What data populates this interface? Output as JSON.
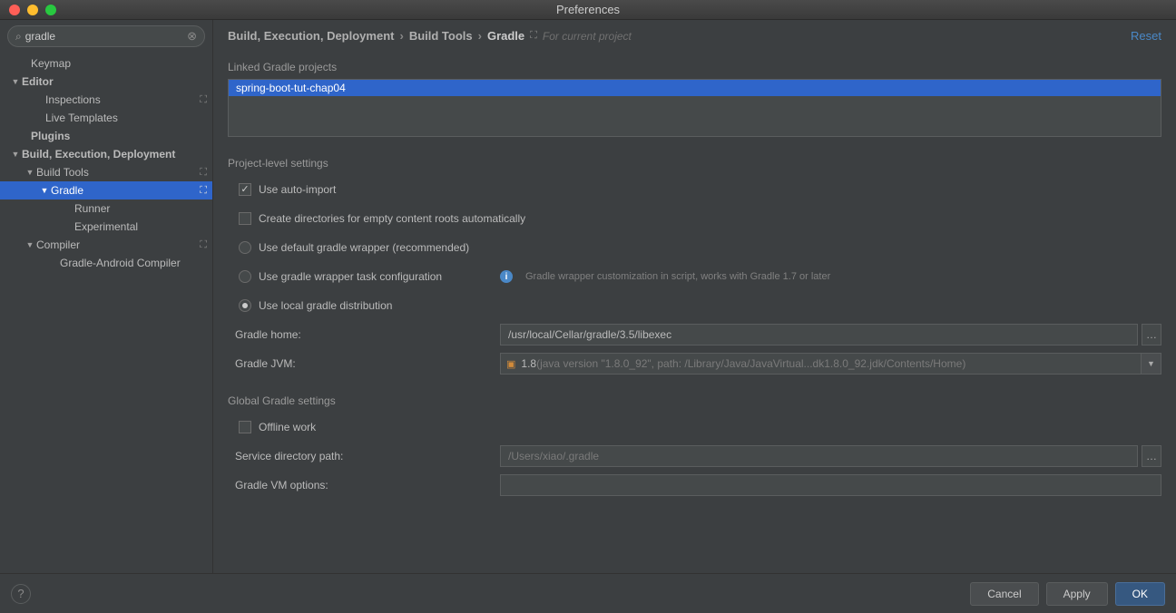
{
  "window": {
    "title": "Preferences"
  },
  "search": {
    "value": "gradle"
  },
  "tree": {
    "keymap": "Keymap",
    "editor": "Editor",
    "inspections": "Inspections",
    "live_templates": "Live Templates",
    "plugins": "Plugins",
    "bed": "Build, Execution, Deployment",
    "build_tools": "Build Tools",
    "gradle": "Gradle",
    "runner": "Runner",
    "experimental": "Experimental",
    "compiler": "Compiler",
    "gac": "Gradle-Android Compiler"
  },
  "breadcrumb": {
    "a": "Build, Execution, Deployment",
    "b": "Build Tools",
    "c": "Gradle",
    "scope": "For current project",
    "reset": "Reset"
  },
  "linked": {
    "label": "Linked Gradle projects",
    "project": "spring-boot-tut-chap04"
  },
  "project_settings": {
    "label": "Project-level settings",
    "auto_import": "Use auto-import",
    "create_dirs": "Create directories for empty content roots automatically",
    "use_default_wrapper": "Use default gradle wrapper (recommended)",
    "use_wrapper_task": "Use gradle wrapper task configuration",
    "wrapper_hint": "Gradle wrapper customization in script, works with Gradle 1.7 or later",
    "use_local": "Use local gradle distribution",
    "gradle_home_label": "Gradle home:",
    "gradle_home_value": "/usr/local/Cellar/gradle/3.5/libexec",
    "gradle_jvm_label": "Gradle JVM:",
    "gradle_jvm_prefix": "1.8",
    "gradle_jvm_detail": " (java version \"1.8.0_92\", path: /Library/Java/JavaVirtual...dk1.8.0_92.jdk/Contents/Home)"
  },
  "global": {
    "label": "Global Gradle settings",
    "offline": "Offline work",
    "service_dir_label": "Service directory path:",
    "service_dir_value": "/Users/xiao/.gradle",
    "vm_options_label": "Gradle VM options:",
    "vm_options_value": ""
  },
  "buttons": {
    "cancel": "Cancel",
    "apply": "Apply",
    "ok": "OK"
  }
}
